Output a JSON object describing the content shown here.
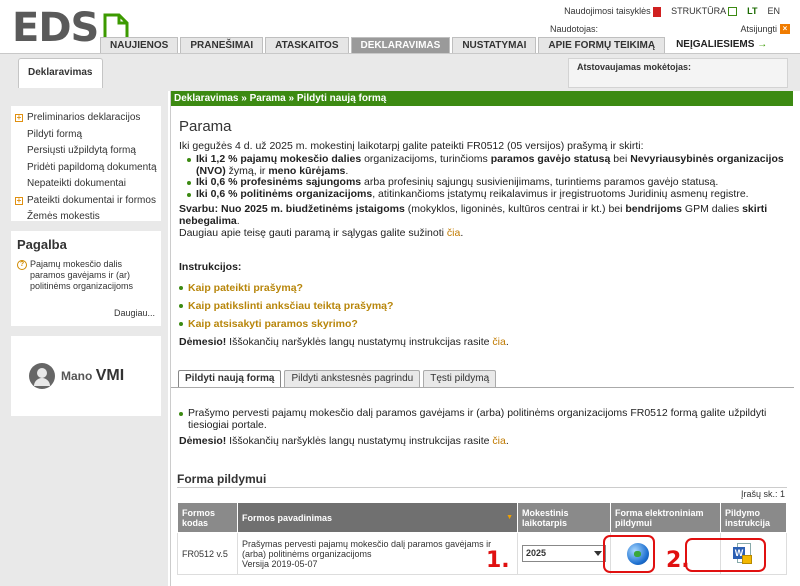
{
  "header": {
    "logo": "EDS",
    "links": {
      "guide": "Naudojimosi taisyklės",
      "structure": "STRUKTŪRA",
      "lang_lt": "LT",
      "lang_en": "EN"
    },
    "user_label": "Naudotojas:",
    "logout": "Atsijungti",
    "nav": [
      "NAUJIENOS",
      "PRANEŠIMAI",
      "ATASKAITOS",
      "DEKLARAVIMAS",
      "NUSTATYMAI",
      "APIE FORMŲ TEIKIMĄ"
    ],
    "nav_special": "NEĮGALIESIEMS"
  },
  "subtab": "Deklaravimas",
  "represented_label": "Atstovaujamas mokėtojas:",
  "sidebar": {
    "menu": [
      {
        "label": "Preliminarios deklaracijos",
        "expandable": true
      },
      {
        "label": "Pildyti formą",
        "expandable": false
      },
      {
        "label": "Persiųsti užpildytą formą",
        "expandable": false
      },
      {
        "label": "Pridėti papildomą dokumentą",
        "expandable": false
      },
      {
        "label": "Nepateikti dokumentai",
        "expandable": false
      },
      {
        "label": "Pateikti dokumentai ir formos",
        "expandable": true
      },
      {
        "label": "Žemės mokestis",
        "expandable": false
      }
    ],
    "help": {
      "title": "Pagalba",
      "question": "Pajamų mokesčio dalis paramos gavėjams ir (ar) politinėms organizacijoms",
      "more": "Daugiau..."
    },
    "vmi_small": "Mano",
    "vmi_big": "VMI"
  },
  "breadcrumb": "Deklaravimas » Parama » Pildyti naują formą",
  "main": {
    "title": "Parama",
    "intro": "Iki gegužės 4 d. už 2025 m. mokestinį laikotarpį galite pateikti FR0512 (05 versijos) prašymą ir skirti:",
    "b1_pre": "Iki 1,2 % pajamų mokesčio dalies",
    "b1_mid1": " organizacijoms, turinčioms ",
    "b1_bold2": "paramos gavėjo statusą",
    "b1_mid2": " bei ",
    "b1_bold3": "Nevyriausybinės organizacijos (NVO)",
    "b1_mid3": " žymą, ir ",
    "b1_bold4": "meno kūrėjams",
    "b1_end": ".",
    "b2_pre": "Iki 0,6 % profesinėms sąjungoms",
    "b2_end": " arba profesinių sąjungų susivienijimams, turintiems paramos gavėjo statusą.",
    "b3_pre": "Iki 0,6 % politinėms organizacijoms",
    "b3_end": ", atitinkančioms įstatymų reikalavimus ir įregistruotoms Juridinių asmenų registre.",
    "svarbu_bold": "Svarbu: Nuo 2025 m. biudžetinėms įstaigoms",
    "svarbu_mid": " (mokyklos, ligoninės, kultūros centrai ir kt.) bei ",
    "svarbu_bold2": "bendrijoms",
    "svarbu_mid2": " GPM dalies ",
    "svarbu_bold3": "skirti nebegalima",
    "svarbu_end": ".",
    "more_text": "Daugiau apie teisę gauti paramą ir sąlygas galite sužinoti ",
    "more_link": "čia",
    "more_end": ".",
    "instr_title": "Instrukcijos:",
    "instr": [
      "Kaip pateikti prašymą?",
      "Kaip patikslinti anksčiau teiktą prašymą?",
      "Kaip atsisakyti paramos skyrimo?"
    ],
    "attention_bold": "Dėmesio!",
    "attention_text": " Iššokančių naršyklės langų nustatymų instrukcijas rasite ",
    "attention_link": "čia",
    "attention_end": ".",
    "tabs": [
      "Pildyti naują formą",
      "Pildyti ankstesnės pagrindu",
      "Tęsti pildymą"
    ],
    "tab_bullet": "Prašymo pervesti pajamų mokesčio dalį paramos gavėjams ir (arba) politinėms organizacijoms FR0512 formą galite užpildyti tiesiogiai portale.",
    "form_title": "Forma pildymui",
    "records": "Įrašų sk.: 1",
    "table": {
      "headers": [
        "Formos kodas",
        "Formos pavadinimas",
        "Mokestinis laikotarpis",
        "Forma elektroniniam pildymui",
        "Pildymo instrukcija"
      ],
      "row": {
        "code": "FR0512 v.5",
        "name": "Prašymas pervesti pajamų mokesčio dalį paramos gavėjams ir (arba) politinėms organizacijoms",
        "version": "Versija 2019-05-07",
        "period": "2025"
      }
    }
  },
  "annotations": [
    "1.",
    "2."
  ]
}
